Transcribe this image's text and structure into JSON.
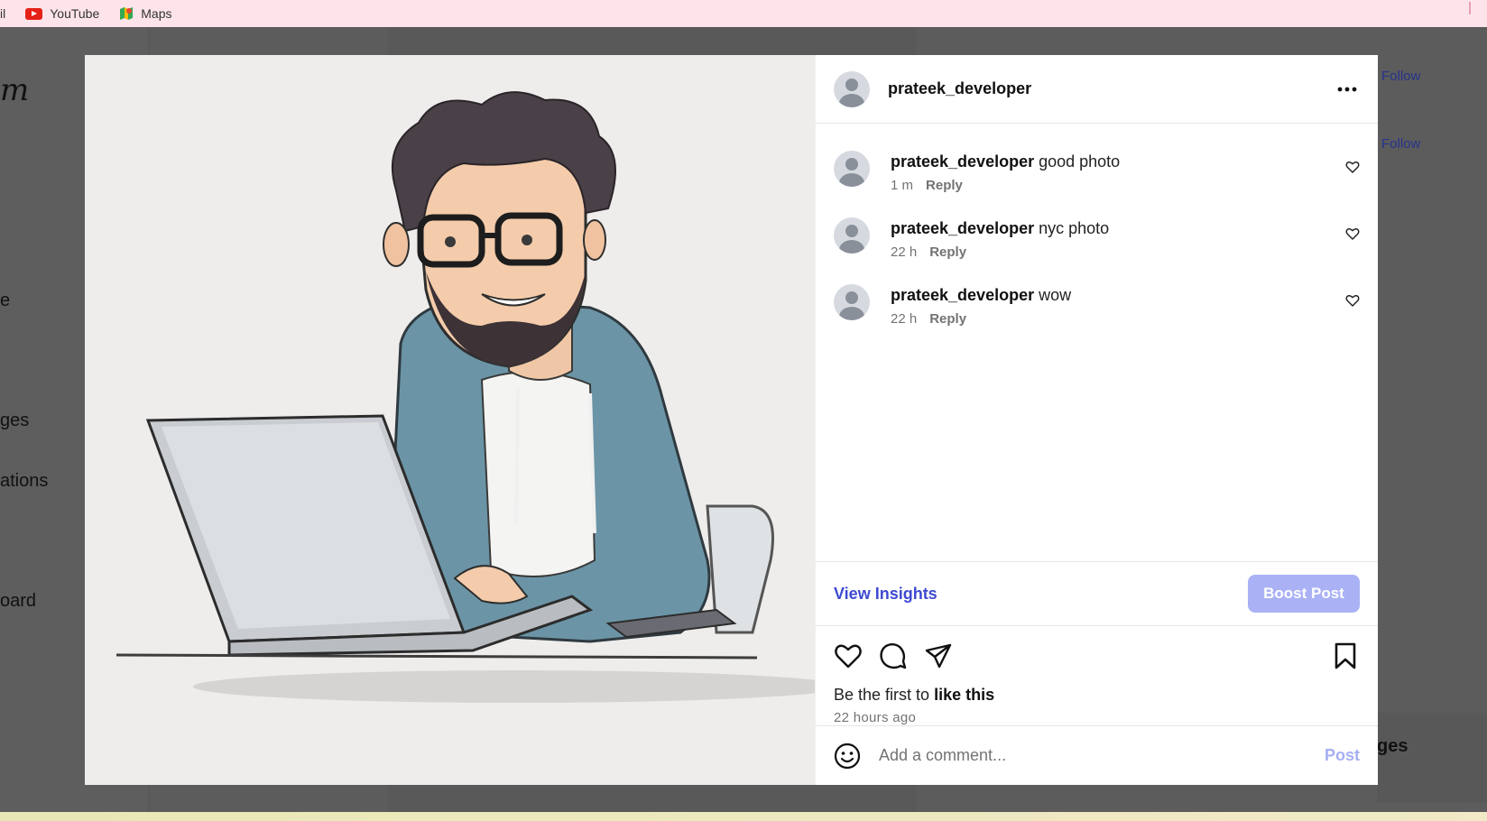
{
  "bookmarks": {
    "first_partial": "il",
    "youtube": "YouTube",
    "maps": "Maps"
  },
  "background": {
    "logo_fragment": "m",
    "nav_fragments": [
      "e",
      "ges",
      "ations",
      "oard"
    ],
    "follow_labels": [
      "Follow",
      "Follow"
    ],
    "side_panel_fragment": "ges"
  },
  "post": {
    "author": "prateek_developer",
    "image_icon": "developer-cartoon-illustration",
    "comments": [
      {
        "user": "prateek_developer",
        "text": "good photo",
        "time": "1 m",
        "reply": "Reply"
      },
      {
        "user": "prateek_developer",
        "text": "nyc photo",
        "time": "22 h",
        "reply": "Reply"
      },
      {
        "user": "prateek_developer",
        "text": "wow",
        "time": "22 h",
        "reply": "Reply"
      }
    ],
    "view_insights": "View Insights",
    "boost_post": "Boost Post",
    "likes_prefix": "Be the first to",
    "likes_action": "like this",
    "time_ago": "22 hours ago",
    "comment_placeholder": "Add a comment...",
    "post_button": "Post"
  },
  "colors": {
    "link_blue": "#3e4ad1",
    "boost_disabled": "#aab2f5",
    "post_disabled": "#a4b0f2",
    "overlay": "#5c5c5c"
  }
}
